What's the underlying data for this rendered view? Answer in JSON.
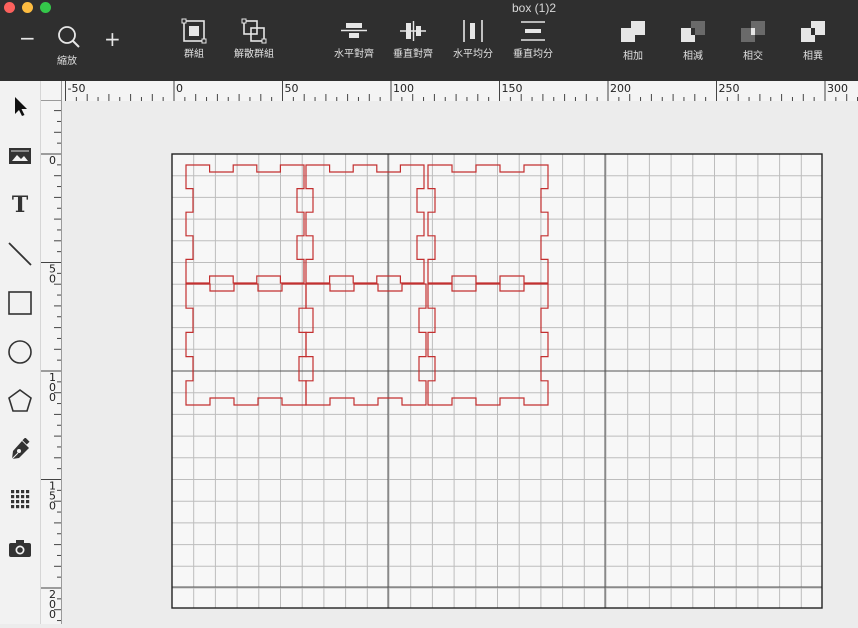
{
  "window": {
    "title": "box (1)2",
    "traffic_lights": [
      "#fc615d",
      "#fdbc40",
      "#34c84a"
    ]
  },
  "toolbar": {
    "zoom_label": "縮放",
    "zoom_out_symbol": "−",
    "zoom_in_symbol": "+",
    "group_label": "群組",
    "ungroup_label": "解散群組",
    "align_h_label": "水平對齊",
    "align_v_label": "垂直對齊",
    "distribute_h_label": "水平均分",
    "distribute_v_label": "垂直均分",
    "union_label": "相加",
    "subtract_label": "相減",
    "intersect_label": "相交",
    "exclude_label": "相異"
  },
  "left_tools": [
    {
      "name": "select-arrow-icon"
    },
    {
      "name": "image-icon"
    },
    {
      "name": "text-icon",
      "glyph": "T"
    },
    {
      "name": "line-icon"
    },
    {
      "name": "rectangle-icon"
    },
    {
      "name": "circle-icon"
    },
    {
      "name": "polygon-icon"
    },
    {
      "name": "pen-icon"
    },
    {
      "name": "grid-icon"
    },
    {
      "name": "camera-icon"
    }
  ],
  "rulers": {
    "horizontal_labels": [
      "-50",
      "0",
      "50",
      "100",
      "150",
      "200",
      "250",
      "300"
    ],
    "vertical_labels": [
      [
        "0"
      ],
      [
        "5",
        "0"
      ],
      [
        "1",
        "0",
        "0"
      ],
      [
        "1",
        "5",
        "0"
      ],
      [
        "2",
        "0",
        "0"
      ]
    ]
  },
  "colors": {
    "cut_path": "#c33030",
    "grid_line": "#bdbdbd",
    "grid_major": "#555555",
    "board_border": "#222222"
  }
}
